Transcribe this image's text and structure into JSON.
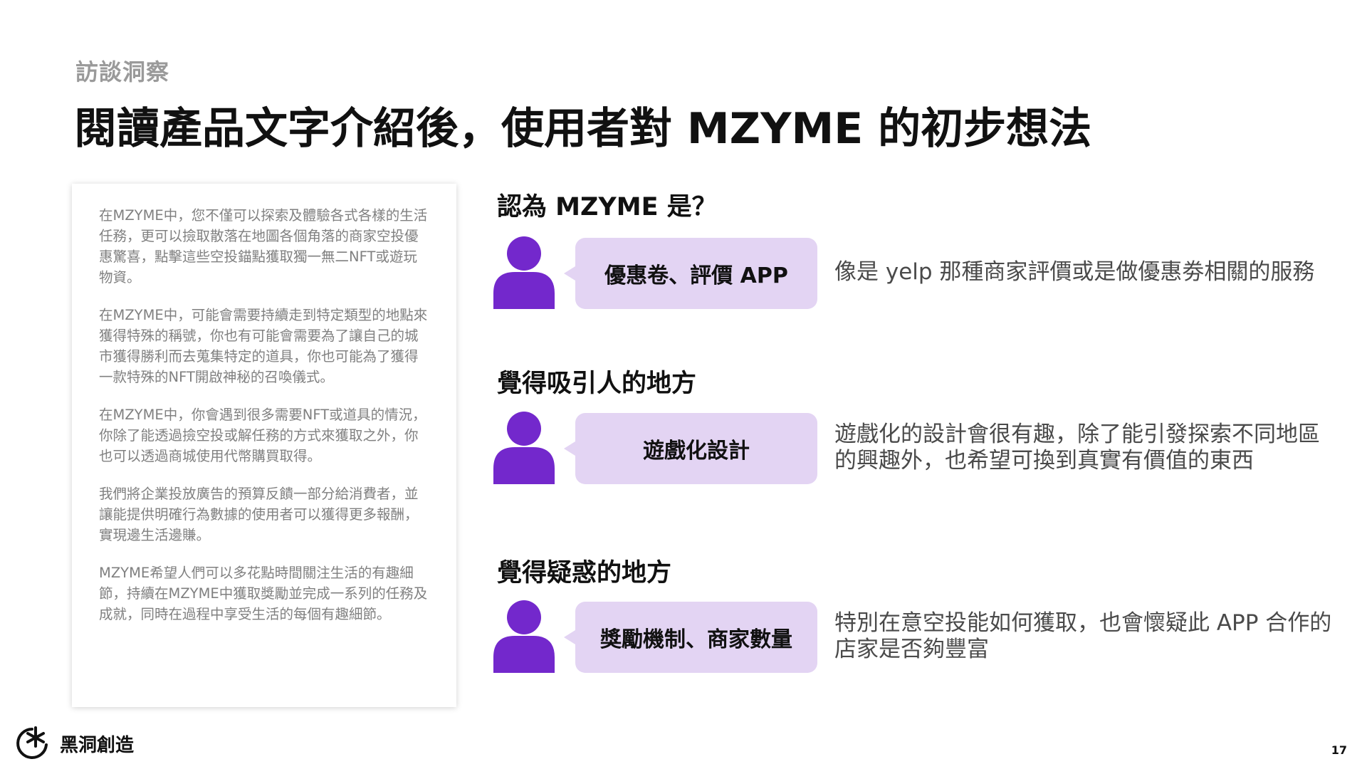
{
  "header": {
    "kicker": "訪談洞察",
    "title": "閱讀產品文字介紹後，使用者對 MZYME 的初步想法"
  },
  "intro_card": {
    "paragraphs": [
      "在MZYME中，您不僅可以探索及體驗各式各樣的生活任務，更可以撿取散落在地圖各個角落的商家空投優惠驚喜，點擊這些空投錨點獲取獨一無二NFT或遊玩物資。",
      "在MZYME中，可能會需要持續走到特定類型的地點來獲得特殊的稱號，你也有可能會需要為了讓自己的城市獲得勝利而去蒐集特定的道具，你也可能為了獲得一款特殊的NFT開啟神秘的召喚儀式。",
      "在MZYME中，你會遇到很多需要NFT或道具的情況，你除了能透過撿空投或解任務的方式來獲取之外，你也可以透過商城使用代幣購買取得。",
      "我們將企業投放廣告的預算反饋一部分給消費者，並讓能提供明確行為數據的使用者可以獲得更多報酬，實現邊生活邊賺。",
      "MZYME希望人們可以多花點時間關注生活的有趣細節，持續在MZYME中獲取獎勵並完成一系列的任務及成就，同時在過程中享受生活的每個有趣細節。"
    ]
  },
  "insights": [
    {
      "label": "認為 MZYME 是？",
      "answer": "優惠卷、評價 APP",
      "quote": "像是 yelp 那種商家評價或是做優惠劵相關的服務"
    },
    {
      "label": "覺得吸引人的地方",
      "answer": "遊戲化設計",
      "quote": "遊戲化的設計會很有趣，除了能引發探索不同地區的興趣外，也希望可換到真實有價值的東西"
    },
    {
      "label": "覺得疑惑的地方",
      "answer": "獎勵機制、商家數量",
      "quote": "特別在意空投能如何獲取，也會懷疑此 APP 合作的店家是否夠豐富"
    }
  ],
  "footer": {
    "brand": "黑洞創造",
    "page_number": "17"
  },
  "colors": {
    "accent_purple": "#7328cc",
    "bubble_lavender": "#e3d4f3",
    "muted_text": "#808080"
  },
  "icons": [
    "person-icon",
    "black-hole-logo-icon"
  ]
}
